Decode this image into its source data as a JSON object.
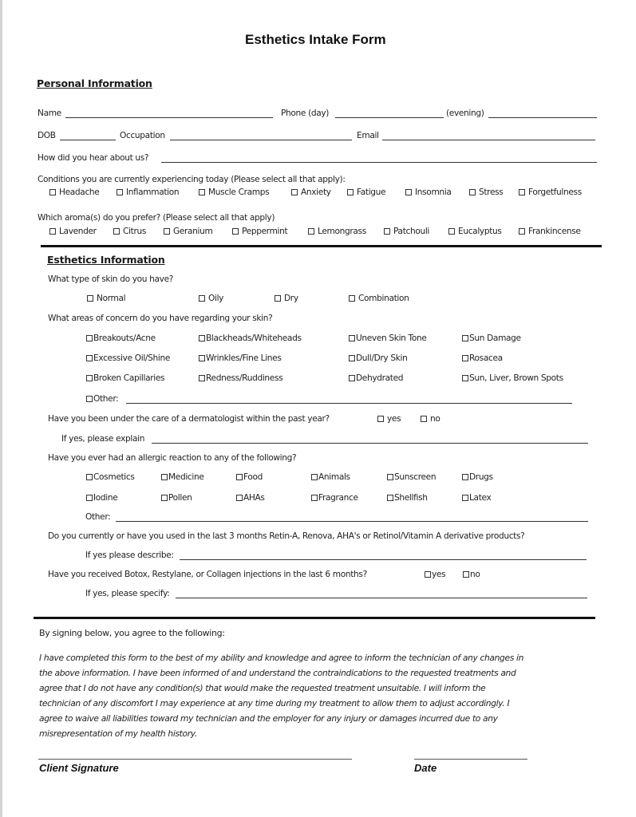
{
  "document": {
    "title": "Esthetics Intake Form"
  },
  "personal": {
    "heading": "Personal Information",
    "name_label": "Name",
    "phone_day_label": "Phone (day)",
    "phone_evening_label": "(evening)",
    "dob_label": "DOB",
    "occupation_label": "Occupation",
    "email_label": "Email",
    "referral_label": "How did you hear about us?",
    "conditions_label": "Conditions you are currently experiencing today (Please select all that apply):",
    "conditions": [
      "Headache",
      "Inflammation",
      "Muscle Cramps",
      "Anxiety",
      "Fatigue",
      "Insomnia",
      "Stress",
      "Forgetfulness"
    ],
    "aromas_label": "Which aroma(s) do you prefer? (Please select all that apply)",
    "aromas": [
      "Lavender",
      "Citrus",
      "Geranium",
      "Peppermint",
      "Lemongrass",
      "Patchouli",
      "Eucalyptus",
      "Frankincense"
    ]
  },
  "esthetics": {
    "heading": "Esthetics Information",
    "skin_type_label": "What type of skin do you have?",
    "skin_types": [
      "Normal",
      "Oily",
      "Dry",
      "Combination"
    ],
    "concerns_label": "What areas of concern do you have regarding your skin?",
    "concerns": [
      "Breakouts/Acne",
      "Blackheads/Whiteheads",
      "Uneven Skin Tone",
      "Sun Damage",
      "Excessive Oil/Shine",
      "Wrinkles/Fine Lines",
      "Dull/Dry Skin",
      "Rosacea",
      "Broken Capillaries",
      "Redness/Ruddiness",
      "Dehydrated",
      "Sun, Liver, Brown Spots"
    ],
    "concerns_other_label": "Other:",
    "dermatologist_label": "Have you been under the care of a dermatologist within the past year?",
    "yes_label": "yes",
    "no_label": "no",
    "dermatologist_explain_label": "If yes, please explain",
    "allergy_label": "Have you ever had an allergic reaction to any of the following?",
    "allergies": [
      "Cosmetics",
      "Medicine",
      "Food",
      "Animals",
      "Sunscreen",
      "Drugs",
      "Iodine",
      "Pollen",
      "AHAs",
      "Fragrance",
      "Shellfish",
      "Latex"
    ],
    "allergy_other_label": "Other:",
    "retin_label": "Do you currently or have you used in the last 3 months Retin-A, Renova, AHA's or Retinol/Vitamin A derivative products?",
    "retin_describe_label": "If yes please describe:",
    "botox_label": "Have you received Botox, Restylane, or Collagen injections in the last 6 months?",
    "botox_specify_label": "If yes, please specify:"
  },
  "agreement": {
    "intro": "By signing below, you agree to the following:",
    "lines": [
      "I have completed this form to the best of my ability and knowledge and agree to inform the technician of any changes in",
      "the above information. I have been informed of and understand the contraindications to the requested treatments and",
      "agree that I do not have any condition(s) that would make the requested treatment unsuitable. I will inform the",
      "technician of any discomfort I may experience at any time during my treatment to allow them to adjust accordingly. I",
      "agree to waive all liabilities toward my technician and the employer for any injury or damages incurred due to any",
      "misrepresentation of my health history."
    ],
    "signature_label": "Client Signature",
    "date_label": "Date"
  }
}
